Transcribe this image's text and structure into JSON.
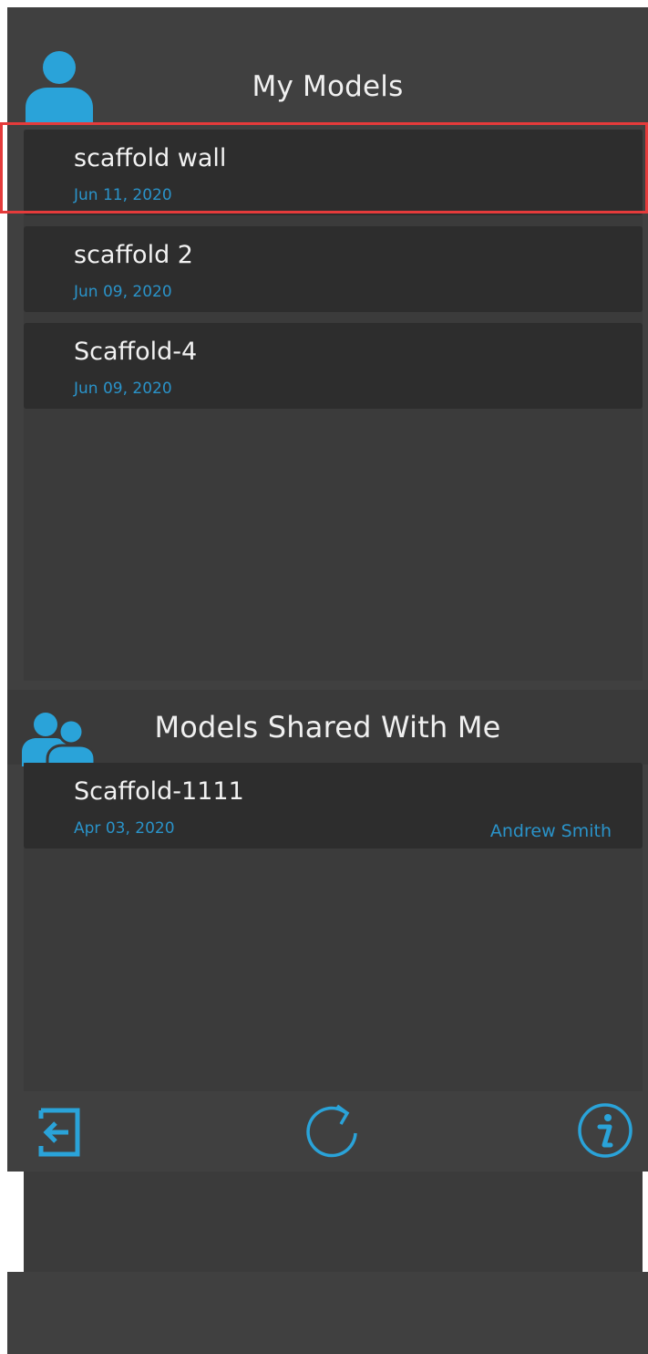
{
  "my_models": {
    "title": "My Models",
    "items": [
      {
        "name": "scaffold wall",
        "date": "Jun 11, 2020"
      },
      {
        "name": "scaffold 2",
        "date": "Jun 09, 2020"
      },
      {
        "name": "Scaffold-4",
        "date": "Jun 09, 2020"
      }
    ]
  },
  "shared_models": {
    "title": "Models Shared With Me",
    "items": [
      {
        "name": "Scaffold-1111",
        "date": "Apr 03, 2020",
        "owner": "Andrew Smith"
      }
    ]
  },
  "icons": {
    "my_models": "user-icon",
    "shared_models": "users-icon",
    "logout": "logout-icon",
    "refresh": "refresh-icon",
    "info": "info-icon"
  },
  "colors": {
    "background": "#404040",
    "item_background": "#2d2d2d",
    "accent": "#2a93c9",
    "text": "#f2f2f2",
    "highlight": "#e53b3b"
  }
}
